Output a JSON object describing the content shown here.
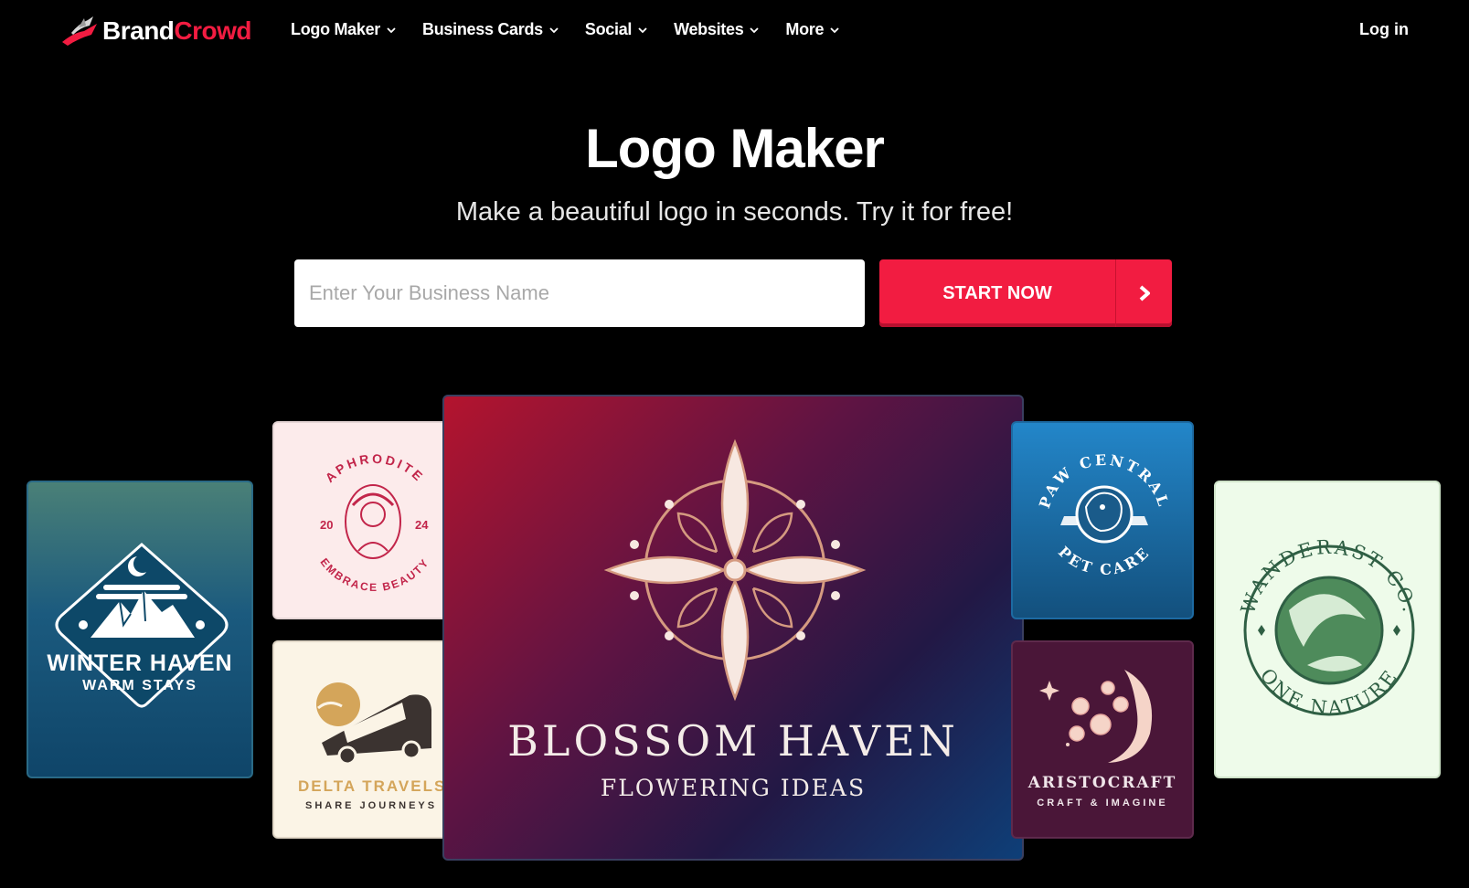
{
  "brand": {
    "part1": "Brand",
    "part2": "Crowd"
  },
  "nav": {
    "items": [
      {
        "label": "Logo Maker"
      },
      {
        "label": "Business Cards"
      },
      {
        "label": "Social"
      },
      {
        "label": "Websites"
      },
      {
        "label": "More"
      }
    ],
    "login": "Log in"
  },
  "hero": {
    "title": "Logo Maker",
    "subtitle": "Make a beautiful logo in seconds. Try it for free!",
    "input_placeholder": "Enter Your Business Name",
    "input_value": "",
    "cta": "START NOW"
  },
  "cards": {
    "winter": {
      "name": "WINTER HAVEN",
      "tag": "WARM STAYS"
    },
    "aphrodite": {
      "arc_top": "APHRODITE",
      "arc_bottom": "EMBRACE BEAUTY",
      "year_left": "20",
      "year_right": "24"
    },
    "delta": {
      "name": "DELTA TRAVELS",
      "tag": "SHARE JOURNEYS"
    },
    "blossom": {
      "name": "BLOSSOM HAVEN",
      "tag": "FLOWERING IDEAS"
    },
    "paw": {
      "arc_top": "PAW CENTRAL",
      "arc_bottom": "PET CARE"
    },
    "aristo": {
      "name": "ARISTOCRAFT",
      "tag": "CRAFT & IMAGINE"
    },
    "wanderast": {
      "arc_top": "WANDERAST CO.",
      "arc_bottom": "ONE NATURE"
    }
  },
  "colors": {
    "accent": "#f21c41",
    "background": "#000000"
  }
}
